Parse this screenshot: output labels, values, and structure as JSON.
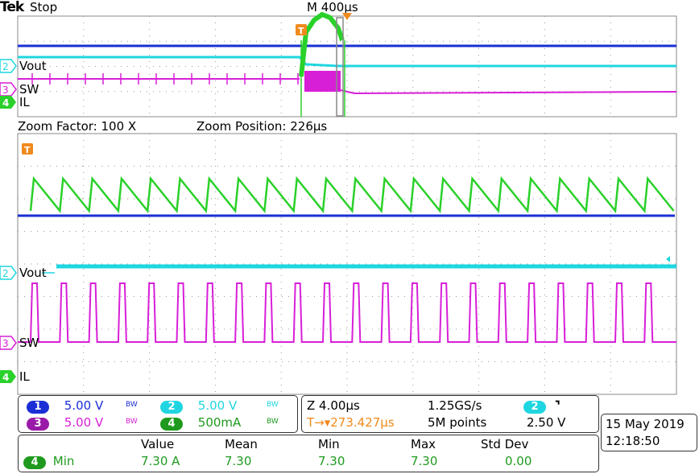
{
  "header": {
    "brand": "Tek",
    "acq_state": "Stop",
    "main_timebase": "M 400µs",
    "zoom_factor": "Zoom Factor: 100 X",
    "zoom_position": "Zoom Position: 226µs"
  },
  "channels": {
    "ch1": {
      "num": "1",
      "scale": "5.00 V",
      "bw": "BW",
      "color": "#1a2fd6"
    },
    "ch2": {
      "num": "2",
      "label": "Vout",
      "scale": "5.00 V",
      "bw": "BW",
      "color": "#1fd6e0"
    },
    "ch3": {
      "num": "3",
      "label": "SW",
      "scale": "5.00 V",
      "bw": "BW",
      "color": "#d81fd8"
    },
    "ch4": {
      "num": "4",
      "label": "IL",
      "scale": "500mA",
      "bw": "BW",
      "color": "#2ad12a"
    }
  },
  "trigger_marker": "T",
  "timebase_panel": {
    "zoom_scale": "Z 4.00µs",
    "sample_rate": "1.25GS/s",
    "trigger_source": "2",
    "trigger_slope_icon": "falling-edge-icon",
    "trigger_position": "T→▾273.427µs",
    "record_length": "5M points",
    "trigger_level": "2.50 V"
  },
  "datetime": {
    "date": "15 May 2019",
    "time": "12:18:50"
  },
  "measurements": {
    "headers": [
      "Value",
      "Mean",
      "Min",
      "Max",
      "Std Dev"
    ],
    "rows": [
      {
        "source": "4",
        "name": "Min",
        "value": "7.30 A",
        "mean": "7.30",
        "min": "7.30",
        "max": "7.30",
        "std_dev": "0.00"
      }
    ]
  }
}
